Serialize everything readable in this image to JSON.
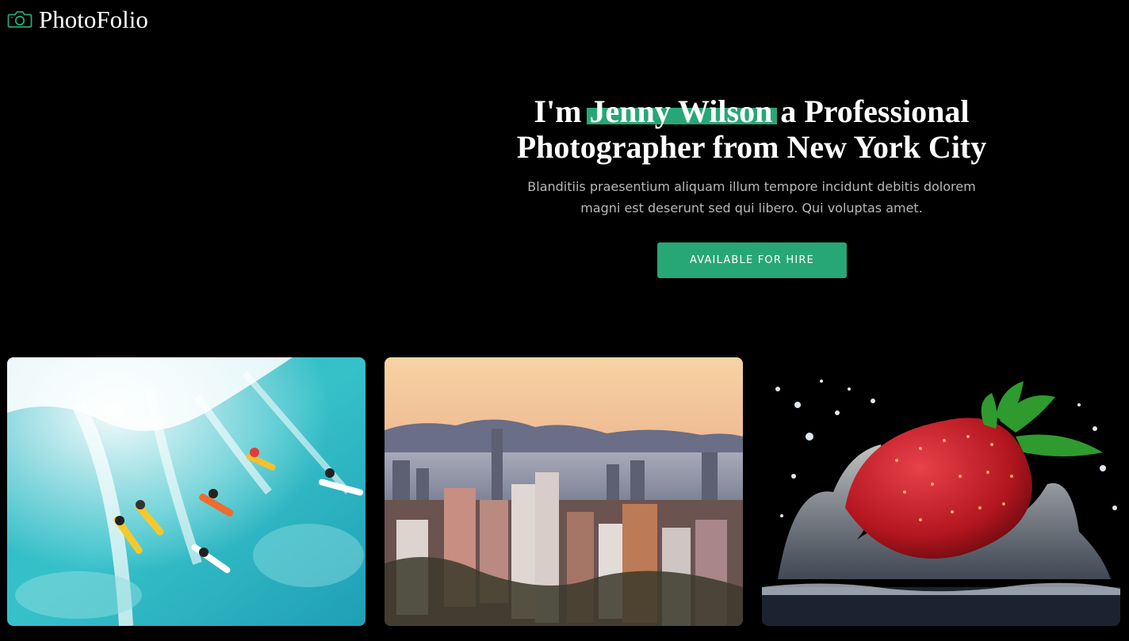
{
  "brand": {
    "name": "PhotoFolio",
    "icon": "camera-icon",
    "accent_color": "#27a776"
  },
  "hero": {
    "title_prefix": "I'm ",
    "title_name": "Jenny Wilson",
    "title_suffix": " a Professional Photographer from New York City",
    "subtitle": "Blanditiis praesentium aliquam illum tempore incidunt debitis dolorem magni est deserunt sed qui libero. Qui voluptas amet.",
    "cta_label": "AVAILABLE FOR HIRE"
  },
  "gallery": {
    "items": [
      {
        "subject": "surfers-on-wave"
      },
      {
        "subject": "city-skyline-sunset"
      },
      {
        "subject": "strawberry-water-splash"
      }
    ]
  }
}
